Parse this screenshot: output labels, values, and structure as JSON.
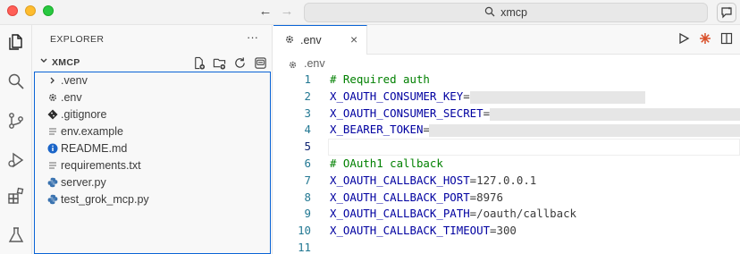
{
  "titlebar": {
    "search_text": "xmcp",
    "back_icon": "arrow-left-icon",
    "forward_icon": "arrow-right-icon"
  },
  "activity_bar": {
    "items": [
      {
        "name": "explorer-icon"
      },
      {
        "name": "search-icon"
      },
      {
        "name": "source-control-icon"
      },
      {
        "name": "run-debug-icon"
      },
      {
        "name": "extensions-icon"
      },
      {
        "name": "testing-icon"
      }
    ]
  },
  "sidebar": {
    "title": "EXPLORER",
    "more": "···",
    "folder": "XMCP",
    "files": [
      {
        "label": ".venv",
        "icon": "chevron-right-icon"
      },
      {
        "label": ".env",
        "icon": "gear-icon"
      },
      {
        "label": ".gitignore",
        "icon": "git-diamond-icon"
      },
      {
        "label": "env.example",
        "icon": "file-lines-icon"
      },
      {
        "label": "README.md",
        "icon": "info-icon"
      },
      {
        "label": "requirements.txt",
        "icon": "file-lines-icon"
      },
      {
        "label": "server.py",
        "icon": "python-icon"
      },
      {
        "label": "test_grok_mcp.py",
        "icon": "python-icon"
      }
    ]
  },
  "editor": {
    "tab_label": ".env",
    "tab_close": "×",
    "breadcrumb": ".env",
    "lines": [
      {
        "num": "1",
        "comment": "# Required auth"
      },
      {
        "num": "2",
        "key": "X_OAUTH_CONSUMER_KEY",
        "eq": "=",
        "value": ""
      },
      {
        "num": "3",
        "key": "X_OAUTH_CONSUMER_SECRET",
        "eq": "=",
        "value": ""
      },
      {
        "num": "4",
        "key": "X_BEARER_TOKEN",
        "eq": "=",
        "value": ""
      },
      {
        "num": "5"
      },
      {
        "num": "6",
        "comment": "# OAuth1 callback"
      },
      {
        "num": "7",
        "key": "X_OAUTH_CALLBACK_HOST",
        "eq": "=",
        "value": "127.0.0.1"
      },
      {
        "num": "8",
        "key": "X_OAUTH_CALLBACK_PORT",
        "eq": "=",
        "value": "8976"
      },
      {
        "num": "9",
        "key": "X_OAUTH_CALLBACK_PATH",
        "eq": "=",
        "value": "/oauth/callback"
      },
      {
        "num": "10",
        "key": "X_OAUTH_CALLBACK_TIMEOUT",
        "eq": "=",
        "value": "300"
      },
      {
        "num": "11"
      }
    ],
    "colors": {
      "key": "#0000a0",
      "comment": "#008000",
      "line_number": "#237893",
      "accent": "#0a64d6"
    }
  }
}
